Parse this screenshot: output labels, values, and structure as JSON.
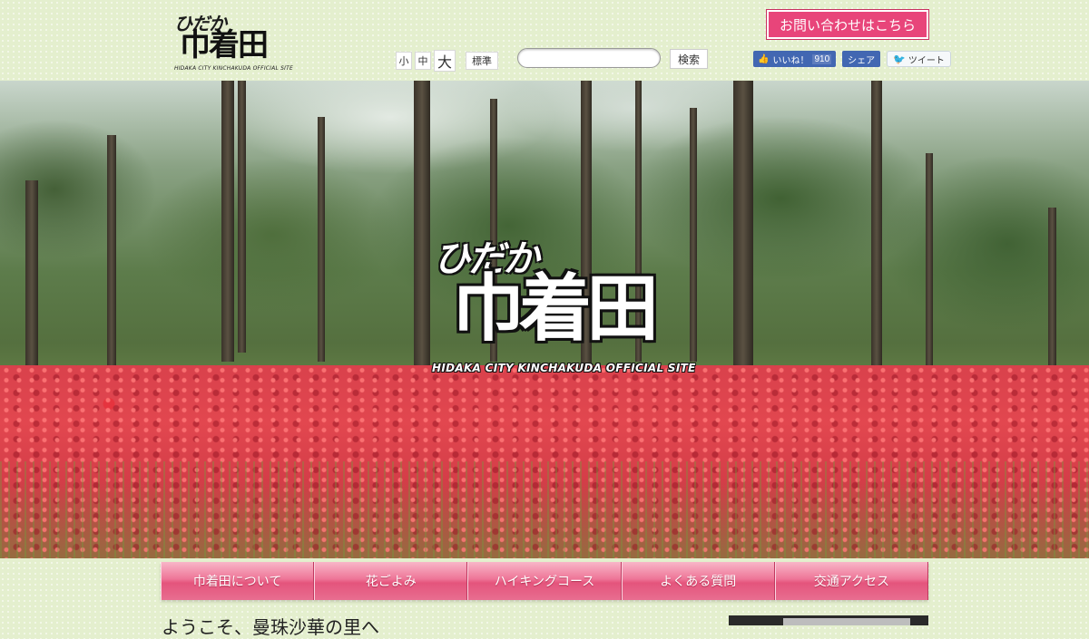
{
  "header": {
    "logo": {
      "hiragana": "ひだか",
      "kanji": "巾着田",
      "subtitle": "HIDAKA CITY KINCHAKUDA OFFICIAL SITE"
    },
    "font_size": {
      "small": "小",
      "medium": "中",
      "large": "大",
      "standard": "標準"
    },
    "search": {
      "placeholder": "",
      "button": "検索"
    },
    "contact_button": "お問い合わせはこちら",
    "social": {
      "like_label": "いいね！",
      "like_count": "910",
      "share_label": "シェア",
      "tweet_label": "ツイート"
    }
  },
  "hero": {
    "logo_hiragana": "ひだか",
    "logo_kanji": "巾着田",
    "logo_subtitle": "HIDAKA CITY KINCHAKUDA OFFICIAL SITE"
  },
  "nav": {
    "items": [
      {
        "label": "巾着田について"
      },
      {
        "label": "花ごよみ"
      },
      {
        "label": "ハイキングコース"
      },
      {
        "label": "よくある質問"
      },
      {
        "label": "交通アクセス"
      }
    ]
  },
  "main": {
    "welcome_heading": "ようこそ、曼珠沙華の里へ"
  },
  "colors": {
    "accent": "#e8457a",
    "nav_pink": "#ee7597",
    "facebook": "#4267b2",
    "background": "#e4efce"
  }
}
